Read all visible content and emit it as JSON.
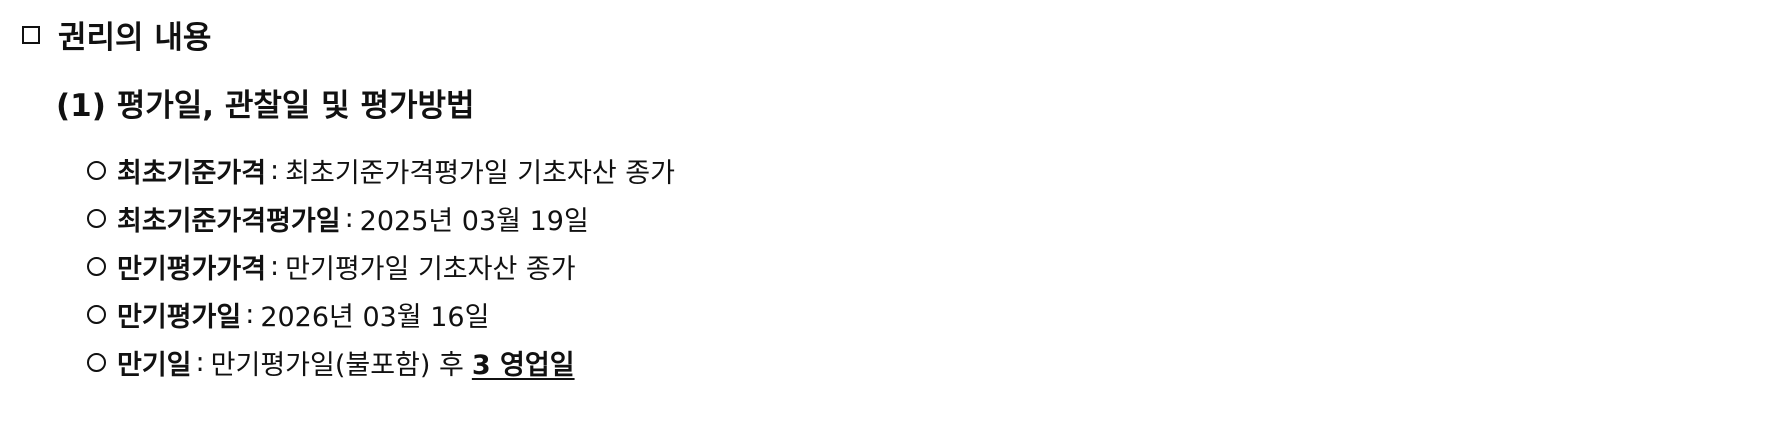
{
  "section": {
    "title": "권리의 내용",
    "icon": "square-outline-icon"
  },
  "subsection": {
    "title": "(1) 평가일, 관찰일 및 평가방법"
  },
  "items": [
    {
      "term": "최초기준가격",
      "separator": ":",
      "description": "최초기준가격평가일 기초자산 종가",
      "emphasis": ""
    },
    {
      "term": "최초기준가격평가일",
      "separator": ":",
      "description": "2025년 03월 19일",
      "emphasis": ""
    },
    {
      "term": "만기평가가격",
      "separator": ":",
      "description": "만기평가일 기초자산 종가",
      "emphasis": ""
    },
    {
      "term": "만기평가일",
      "separator": ":",
      "description": "2026년 03월 16일",
      "emphasis": ""
    },
    {
      "term": "만기일",
      "separator": ":",
      "description": "만기평가일(불포함) 후",
      "emphasis": "3 영업일"
    }
  ]
}
